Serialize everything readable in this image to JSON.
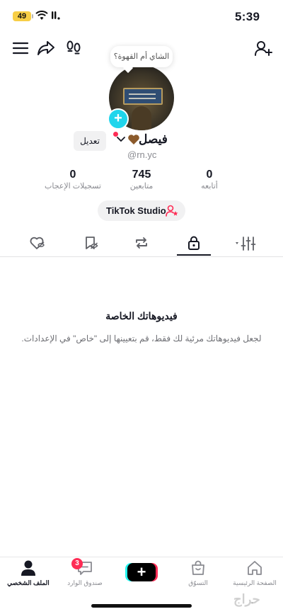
{
  "status_bar": {
    "time": "5:39",
    "battery": "49"
  },
  "header": {
    "bubble_text": "الشاي أم القهوة؟"
  },
  "profile": {
    "name": "فيصل",
    "handle": "@rn.yc",
    "edit_label": "تعديل",
    "stats": [
      {
        "value": "0",
        "label": "تسجيلات الإعجاب"
      },
      {
        "value": "745",
        "label": "متابعين"
      },
      {
        "value": "0",
        "label": "أتابعه"
      }
    ],
    "studio_label": "TikTok Studio"
  },
  "tabs": [
    {
      "icon": "heart-hidden-icon"
    },
    {
      "icon": "bookmark-hidden-icon"
    },
    {
      "icon": "repost-icon"
    },
    {
      "icon": "lock-icon",
      "active": true
    },
    {
      "icon": "filter-sliders-icon"
    }
  ],
  "empty_state": {
    "title": "فيديوهاتك الخاصة",
    "description": "لجعل فيديوهاتك مرئية لك فقط، قم بتعيينها إلى \"خاص\" في الإعدادات."
  },
  "bottom_nav": {
    "profile": "الملف الشخصي",
    "inbox": "صندوق الوارد",
    "inbox_badge": "3",
    "shop": "التسوّق",
    "home": "الصفحة الرئيسية"
  },
  "watermark": "حراج",
  "colors": {
    "accent": "#fe2c55",
    "cyan": "#20d5ec",
    "battery": "#f7ce46"
  }
}
